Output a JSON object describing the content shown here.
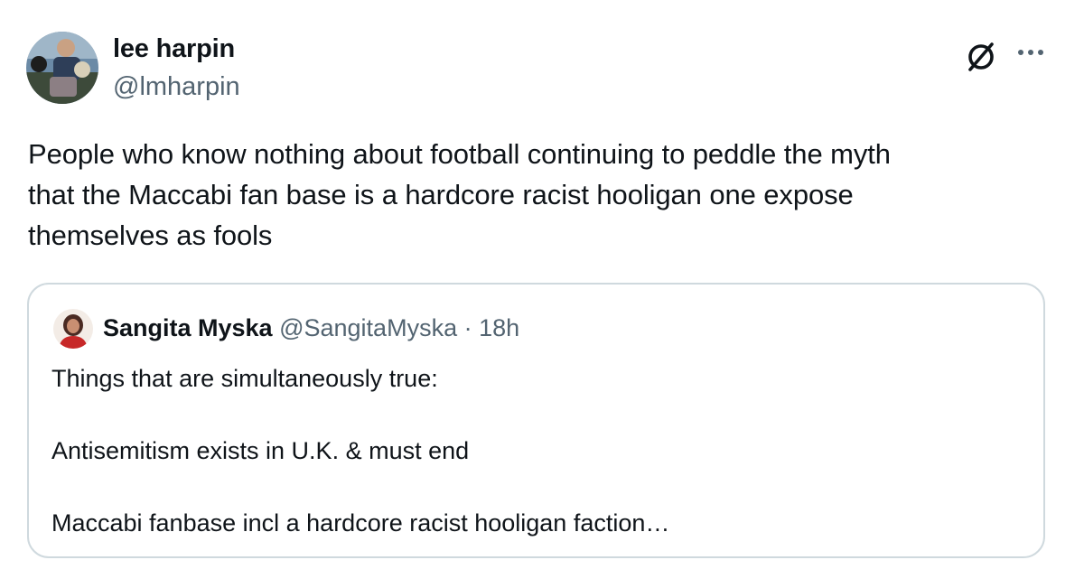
{
  "author": {
    "display_name": "lee harpin",
    "handle": "@lmharpin",
    "avatar_icon": "profile-photo"
  },
  "actions": {
    "grok_icon": "grok-icon",
    "more_icon": "more-icon"
  },
  "tweet": {
    "lines": [
      "People who know nothing about football continuing to peddle the myth",
      "that the Maccabi fan base is a hardcore racist hooligan one expose",
      "themselves as fools"
    ]
  },
  "quote": {
    "display_name": "Sangita Myska",
    "handle": "@SangitaMyska",
    "separator": "·",
    "time": "18h",
    "paragraphs": [
      "Things that are simultaneously true:",
      "Antisemitism exists in U.K. & must end",
      "Maccabi fanbase incl a hardcore racist hooligan faction…"
    ]
  },
  "colors": {
    "text_primary": "#0f1419",
    "text_secondary": "#536471",
    "card_border": "#cfd9de"
  }
}
